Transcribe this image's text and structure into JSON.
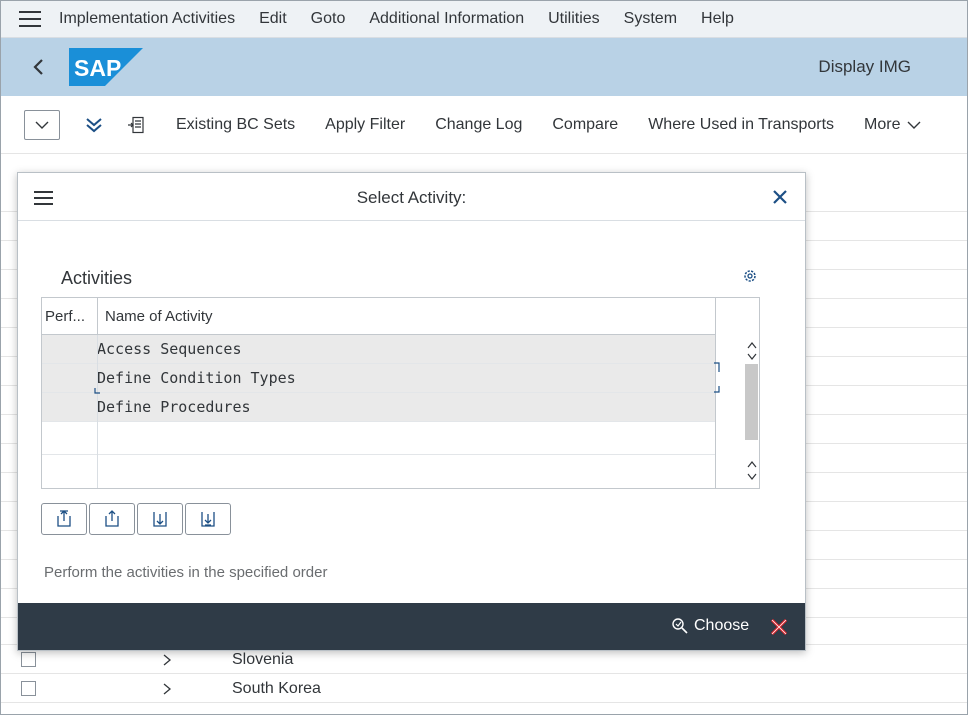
{
  "menubar": {
    "items": [
      "Implementation Activities",
      "Edit",
      "Goto",
      "Additional Information",
      "Utilities",
      "System",
      "Help"
    ]
  },
  "shell": {
    "logo_text": "SAP",
    "title": "Display IMG"
  },
  "toolbar": {
    "existing_bc_sets": "Existing BC Sets",
    "apply_filter": "Apply Filter",
    "change_log": "Change Log",
    "compare": "Compare",
    "where_used": "Where Used in Transports",
    "more": "More"
  },
  "background_list": {
    "rows": [
      {
        "label": "Slovenia"
      },
      {
        "label": "South Korea"
      }
    ]
  },
  "dialog": {
    "title": "Select Activity:",
    "section_title": "Activities",
    "table": {
      "columns": [
        "Perf...",
        "Name of Activity"
      ],
      "rows": [
        {
          "perf": "",
          "name": "Access Sequences"
        },
        {
          "perf": "",
          "name": "Define Condition Types"
        },
        {
          "perf": "",
          "name": "Define Procedures"
        }
      ]
    },
    "hint": "Perform the activities in the specified order",
    "choose_label": "Choose"
  },
  "colors": {
    "shell_bg": "#b9d2e6",
    "footer_bg": "#2f3b47",
    "sap_logo": "#1a8fd8",
    "cancel_red": "#e2242c"
  }
}
